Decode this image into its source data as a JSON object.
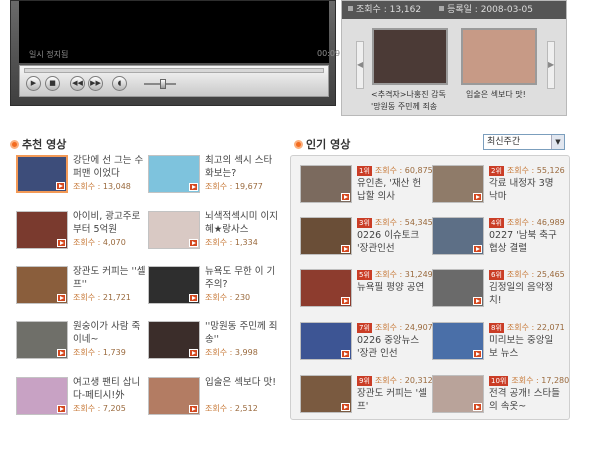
{
  "player": {
    "status": "일시 정지됨",
    "time": "00:09"
  },
  "related": {
    "views_label": "조회수 : 13,162",
    "date_label": "등록일 : 2008-03-05",
    "items": [
      {
        "caption_line1": "<추격자>나홍진 감독",
        "caption_line2": "'망원동 주민께 죄송",
        "thumb_color": "#4b3a36"
      },
      {
        "caption_line1": "입술은 섹보다 맛!",
        "caption_line2": "",
        "thumb_color": "#c79a86"
      }
    ]
  },
  "recommended": {
    "title": "추천 영상",
    "view_label": "조회수 :",
    "items": [
      {
        "title": "강단에 선 그는 수퍼맨 이었다",
        "views": "13,048",
        "thumb": "#3d4d7a"
      },
      {
        "title": "최고의 섹시 스타화보는?",
        "views": "19,677",
        "thumb": "#7ec3dd"
      },
      {
        "title": "아이비, 광고주로부터 5억원",
        "views": "4,070",
        "thumb": "#7a3a2e"
      },
      {
        "title": "뇌색적섹시미 이지혜★랑사스",
        "views": "1,334",
        "thumb": "#d9c9c4"
      },
      {
        "title": "장관도 커피는 ''셀프''",
        "views": "21,721",
        "thumb": "#8a5e3c"
      },
      {
        "title": "뉴욕도 무한 이 기주의?",
        "views": "230",
        "thumb": "#2e2e2e"
      },
      {
        "title": "원숭이가 사람 죽이네~",
        "views": "1,739",
        "thumb": "#6f6f69"
      },
      {
        "title": "''망원동 주민께 죄송''",
        "views": "3,998",
        "thumb": "#3b2d2a"
      },
      {
        "title": "여고생 팬티 삽니다-페티시!外",
        "views": "7,205",
        "thumb": "#c8a2c4"
      },
      {
        "title": "입술은 섹보다 맛!",
        "views": "2,512",
        "thumb": "#b37c63"
      }
    ]
  },
  "popular": {
    "title": "인기 영상",
    "period_selected": "최신주간",
    "view_label": "조회수 :",
    "items": [
      {
        "rank": "1위",
        "views": "60,875",
        "title": "유인촌, '재산 헌납할 의사",
        "thumb": "#7b6a5e"
      },
      {
        "rank": "2위",
        "views": "55,126",
        "title": "각료 내정자 3명 낙마",
        "thumb": "#8f7b69"
      },
      {
        "rank": "3위",
        "views": "54,345",
        "title": "0226 이슈토크 '장관인선",
        "thumb": "#6a4e37"
      },
      {
        "rank": "4위",
        "views": "46,989",
        "title": "0227 '남북 축구협상 결렬",
        "thumb": "#5d6f86"
      },
      {
        "rank": "5위",
        "views": "31,249",
        "title": "뉴욕필 평양 공연",
        "thumb": "#8d3c2e"
      },
      {
        "rank": "6위",
        "views": "25,465",
        "title": "김정일의 음악정치!",
        "thumb": "#6a6a6a"
      },
      {
        "rank": "7위",
        "views": "24,907",
        "title": "0226 중앙뉴스 '장관 인선",
        "thumb": "#3d5594"
      },
      {
        "rank": "8위",
        "views": "22,071",
        "title": "미리보는 중앙일보 뉴스",
        "thumb": "#4a6fa8"
      },
      {
        "rank": "9위",
        "views": "20,312",
        "title": "장관도 커피는 '셀프'",
        "thumb": "#7a5a40"
      },
      {
        "rank": "10위",
        "views": "17,280",
        "title": "전격 공개! 스타들의 속옷~",
        "thumb": "#b9a39a"
      }
    ]
  }
}
